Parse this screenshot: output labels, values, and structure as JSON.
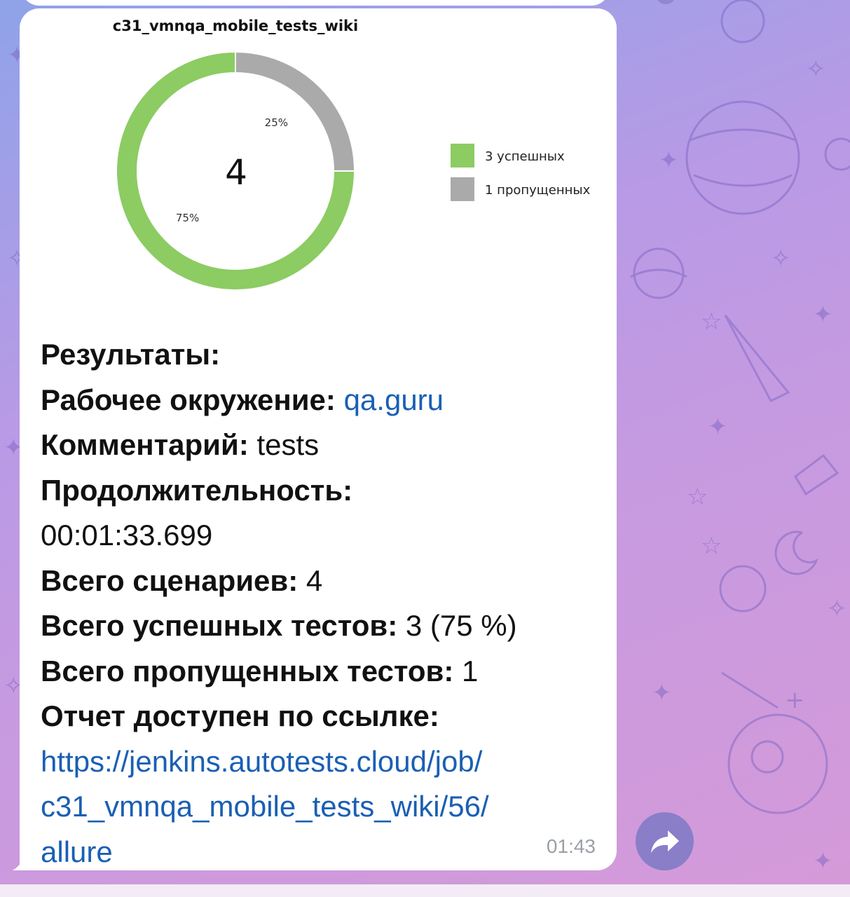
{
  "chart_data": {
    "type": "pie",
    "title": "c31_vmnqa_mobile_tests_wiki",
    "center_label": "4",
    "slices": [
      {
        "label": "3 успешных",
        "value": 3,
        "percent_label": "75%",
        "color": "#8ccc63"
      },
      {
        "label": "1 пропущенных",
        "value": 1,
        "percent_label": "25%",
        "color": "#aaaaaa"
      }
    ],
    "legend_position": "right"
  },
  "message": {
    "results_label": "Результаты:",
    "env_label": "Рабочее окружение:",
    "env_value": "qa.guru",
    "comment_label": "Комментарий:",
    "comment_value": "tests",
    "duration_label": "Продолжительность:",
    "duration_value": "00:01:33.699",
    "scenarios_label": "Всего сценариев:",
    "scenarios_value": "4",
    "passed_label": "Всего успешных тестов:",
    "passed_value": "3 (75 %)",
    "skipped_label": "Всего пропущенных тестов:",
    "skipped_value": "1",
    "report_label": "Отчет доступен по ссылке:",
    "report_link_lines": [
      "https://jenkins.autotests.cloud/job/",
      "c31_vmnqa_mobile_tests_wiki/56/",
      "allure"
    ]
  },
  "timestamp": "01:43",
  "icons": {
    "share": "share-forward-icon"
  },
  "colors": {
    "link": "#1a5fb4",
    "share_button": "#8a7ec9",
    "passed": "#8ccc63",
    "skipped": "#aaaaaa"
  }
}
